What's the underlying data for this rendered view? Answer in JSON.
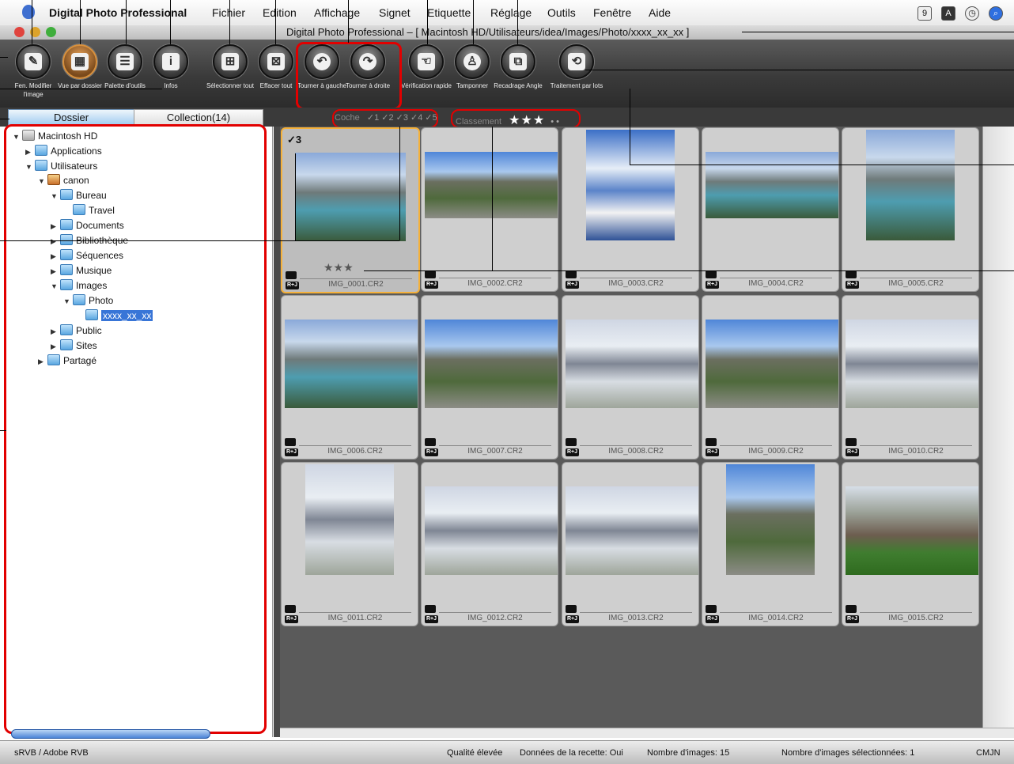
{
  "menubar": {
    "app_name": "Digital Photo Professional",
    "items": [
      "Fichier",
      "Edition",
      "Affichage",
      "Signet",
      "Etiquette",
      "Réglage",
      "Outils",
      "Fenêtre",
      "Aide"
    ]
  },
  "window": {
    "title": "Digital Photo Professional – [ Macintosh HD/Utilisateurs/idea/Images/Photo/xxxx_xx_xx ]"
  },
  "toolbar": {
    "edit_image": "Fen. Modifier l'image",
    "folder_view": "Vue par dossier",
    "tool_palette": "Palette d'outils",
    "info": "Infos",
    "select_all": "Sélectionner tout",
    "clear_all": "Effacer tout",
    "rotate_left": "Tourner à gauche",
    "rotate_right": "Tourner à droite",
    "quick_check": "Vérification rapide",
    "stamp": "Tamponner",
    "crop": "Recadrage Angle",
    "batch": "Traitement par lots"
  },
  "tabs": {
    "folder": "Dossier",
    "collection": "Collection(14)"
  },
  "filter": {
    "check_label": "Coche",
    "check_values": "✓1 ✓2 ✓3 ✓4 ✓5",
    "rating_label": "Classement",
    "rating_stars": "★★★",
    "rating_dots": "• •"
  },
  "tree": {
    "macintosh_hd": "Macintosh HD",
    "applications": "Applications",
    "users": "Utilisateurs",
    "canon": "canon",
    "bureau": "Bureau",
    "travel": "Travel",
    "documents": "Documents",
    "bibliotheque": "Bibliothèque",
    "sequences": "Séquences",
    "musique": "Musique",
    "images": "Images",
    "photo": "Photo",
    "xxxx": "xxxx_xx_xx",
    "public": "Public",
    "sites": "Sites",
    "partage": "Partagé"
  },
  "thumbnails": {
    "rj_badge": "R+J",
    "check_mark": "✓3",
    "stars": "★★★",
    "names": [
      "IMG_0001.CR2",
      "IMG_0002.CR2",
      "IMG_0003.CR2",
      "IMG_0004.CR2",
      "IMG_0005.CR2",
      "IMG_0006.CR2",
      "IMG_0007.CR2",
      "IMG_0008.CR2",
      "IMG_0009.CR2",
      "IMG_0010.CR2",
      "IMG_0011.CR2",
      "IMG_0012.CR2",
      "IMG_0013.CR2",
      "IMG_0014.CR2",
      "IMG_0015.CR2"
    ]
  },
  "statusbar": {
    "color_space": "sRVB / Adobe RVB",
    "quality": "Qualité élevée",
    "recipe": "Données de la recette: Oui",
    "count": "Nombre d'images: 15",
    "selected": "Nombre d'images sélectionnées: 1",
    "cmyk": "CMJN"
  }
}
